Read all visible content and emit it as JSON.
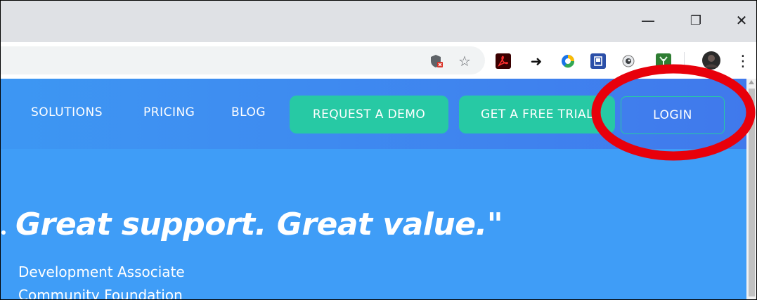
{
  "browser": {
    "window_controls": {
      "minimize_glyph": "—",
      "restore_glyph": "❐",
      "close_glyph": "✕"
    },
    "toolbar_icons": [
      {
        "name": "shield-blocked-icon",
        "glyph": "⛉"
      },
      {
        "name": "bookmark-star-icon",
        "glyph": "☆"
      },
      {
        "name": "acrobat-icon",
        "glyph": "⅄"
      },
      {
        "name": "share-arrow-icon",
        "glyph": "➜"
      },
      {
        "name": "chrome-extension-icon",
        "glyph": "◍"
      },
      {
        "name": "reader-icon",
        "glyph": "▣"
      },
      {
        "name": "eye-extension-icon",
        "glyph": "◉"
      },
      {
        "name": "plant-extension-icon",
        "glyph": "¥"
      },
      {
        "name": "profile-avatar-icon",
        "glyph": "●"
      },
      {
        "name": "menu-kebab-icon",
        "glyph": "⋮"
      }
    ]
  },
  "nav": {
    "links": [
      "SOLUTIONS",
      "PRICING",
      "BLOG"
    ],
    "request_demo": "REQUEST A DEMO",
    "free_trial": "GET A FREE TRIAL",
    "login": "LOGIN"
  },
  "hero": {
    "quote": "Great support. Great value.\"",
    "attribution_title": "Development Associate",
    "attribution_org": "Community Foundation"
  },
  "colors": {
    "page_blue": "#3f9df7",
    "button_teal": "#27c9a4",
    "annotation_red": "#e8000b"
  }
}
